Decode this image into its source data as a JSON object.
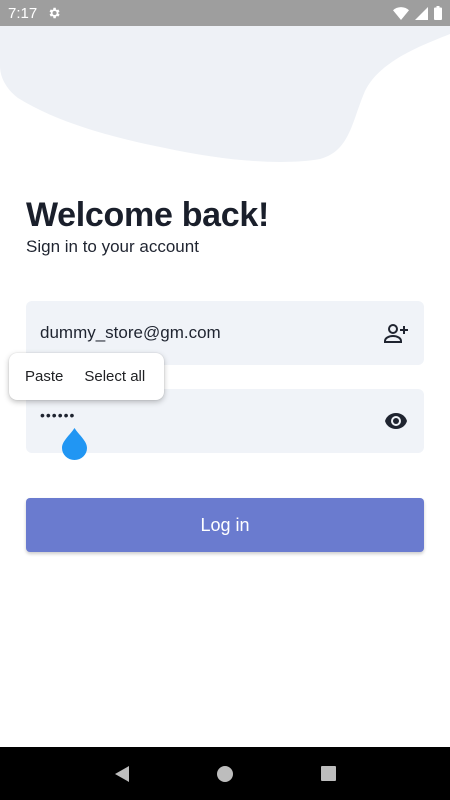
{
  "status_bar": {
    "time": "7:17",
    "icons": [
      "gear-icon",
      "wifi-icon",
      "signal-icon",
      "battery-icon"
    ]
  },
  "login": {
    "title": "Welcome back!",
    "subtitle": "Sign in to your account",
    "email_value": "dummy_store@gm.com",
    "email_trailing_icon": "person-add-icon",
    "password_value": "••••••",
    "password_trailing_icon": "eye-icon",
    "login_button_label": "Log in"
  },
  "selection_popup": {
    "paste_label": "Paste",
    "select_all_label": "Select all"
  },
  "nav_bar": {
    "icons": [
      "back-triangle-icon",
      "home-circle-icon",
      "recents-square-icon"
    ]
  },
  "colors": {
    "status_bar": "#9e9e9e",
    "blob": "#eef1f6",
    "field_bg": "#f0f3f8",
    "button_bg": "#6a7bcf",
    "cursor_handle": "#2196f3",
    "title": "#1a1f2b"
  }
}
